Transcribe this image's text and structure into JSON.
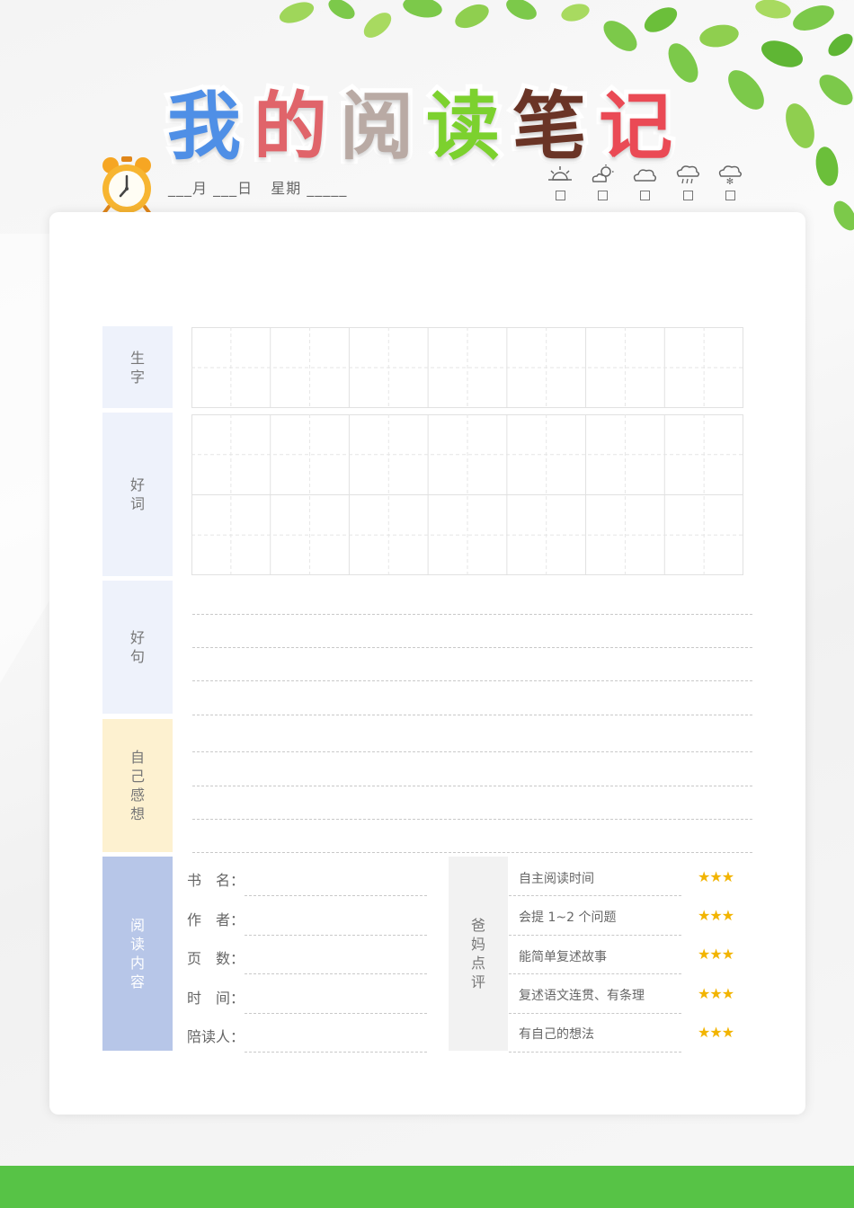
{
  "title": {
    "chars": [
      {
        "text": "我",
        "color": "#4f8fe6"
      },
      {
        "text": "的",
        "color": "#e0646a"
      },
      {
        "text": "阅",
        "color": "#b9aaa4"
      },
      {
        "text": "读",
        "color": "#7cd12e"
      },
      {
        "text": "笔",
        "color": "#6a3426"
      },
      {
        "text": "记",
        "color": "#ea4a55"
      }
    ]
  },
  "date": {
    "month_label": "月",
    "day_label": "日",
    "weekday_label": "星期"
  },
  "weather_icons": [
    "sunny-icon",
    "partly-cloudy-icon",
    "cloudy-icon",
    "rain-icon",
    "snow-icon"
  ],
  "sections": {
    "new_chars": {
      "label": [
        "生",
        "字"
      ]
    },
    "good_words": {
      "label": [
        "好",
        "词"
      ]
    },
    "good_sentences": {
      "label": [
        "好",
        "句"
      ]
    },
    "thoughts": {
      "label": [
        "自",
        "己",
        "感",
        "想"
      ]
    },
    "reading_content": {
      "label": [
        "阅",
        "读",
        "内",
        "容"
      ]
    }
  },
  "info_fields": [
    {
      "label": "书　名："
    },
    {
      "label": "作　者："
    },
    {
      "label": "页　数："
    },
    {
      "label": "时　间："
    },
    {
      "label": "陪读人："
    }
  ],
  "parent_eval": {
    "label": [
      "爸",
      "妈",
      "点",
      "评"
    ],
    "items": [
      {
        "text": "自主阅读时间",
        "stars": "★★★"
      },
      {
        "text": "会提 1~2 个问题",
        "stars": "★★★"
      },
      {
        "text": "能简单复述故事",
        "stars": "★★★"
      },
      {
        "text": "复述语文连贯、有条理",
        "stars": "★★★"
      },
      {
        "text": "有自己的想法",
        "stars": "★★★"
      }
    ]
  },
  "colors": {
    "label_blue": "#eef2fb",
    "label_yellow": "#fdf1d0",
    "label_dark_blue": "#b7c6e8",
    "bottom_bar": "#57c346",
    "star": "#f2b400"
  }
}
